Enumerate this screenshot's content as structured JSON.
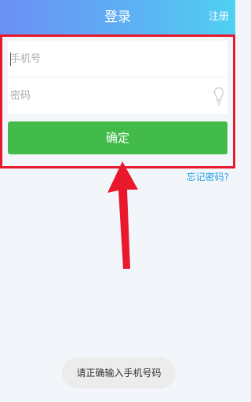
{
  "header": {
    "title": "登录",
    "register_label": "注册"
  },
  "form": {
    "phone_placeholder": "手机号",
    "password_placeholder": "密码",
    "password_toggle_icon": "lightbulb-icon"
  },
  "confirm_label": "确定",
  "forgot_password_label": "忘记密码?",
  "toast_message": "请正确输入手机号码",
  "annotation": {
    "highlight_color": "#e8192c",
    "arrow_color": "#e8192c"
  },
  "colors": {
    "header_gradient_start": "#6a8ff5",
    "header_gradient_end": "#4fd0f2",
    "confirm_button": "#43bb4a",
    "link": "#1f9ee6"
  }
}
